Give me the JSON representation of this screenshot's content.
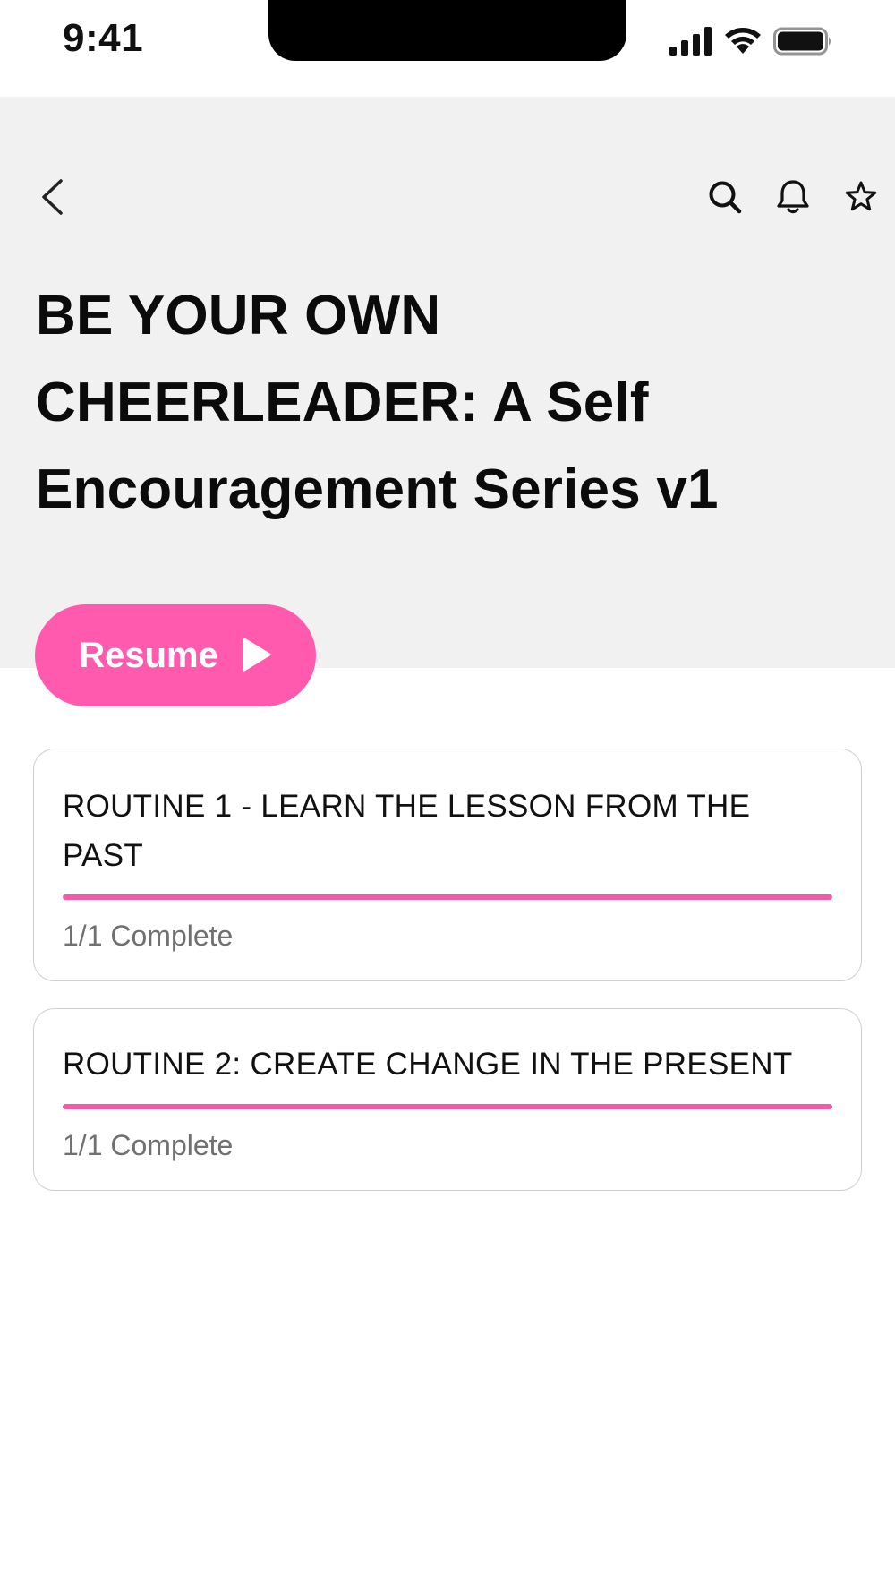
{
  "status_bar": {
    "time": "9:41",
    "icons": [
      "cellular-signal-icon",
      "wifi-icon",
      "battery-icon"
    ]
  },
  "header": {
    "back_icon": "chevron-left-icon",
    "actions": [
      "search-icon",
      "bell-icon",
      "star-icon"
    ],
    "title": "BE YOUR OWN CHEERLEADER: A Self Encouragement Series v1",
    "background": "#f1f1f1"
  },
  "resume": {
    "label": "Resume",
    "icon": "play-icon",
    "color": "#ff5aae"
  },
  "routines": [
    {
      "title": "ROUTINE 1 - LEARN THE LESSON FROM THE PAST",
      "status": "1/1 Complete",
      "progress": 1.0
    },
    {
      "title": "ROUTINE 2: CREATE CHANGE IN THE PRESENT",
      "status": "1/1 Complete",
      "progress": 1.0
    }
  ],
  "colors": {
    "accent": "#ff5aae",
    "progress": "#f45aa8",
    "muted_text": "#707070",
    "card_border": "#cfcfcf"
  }
}
